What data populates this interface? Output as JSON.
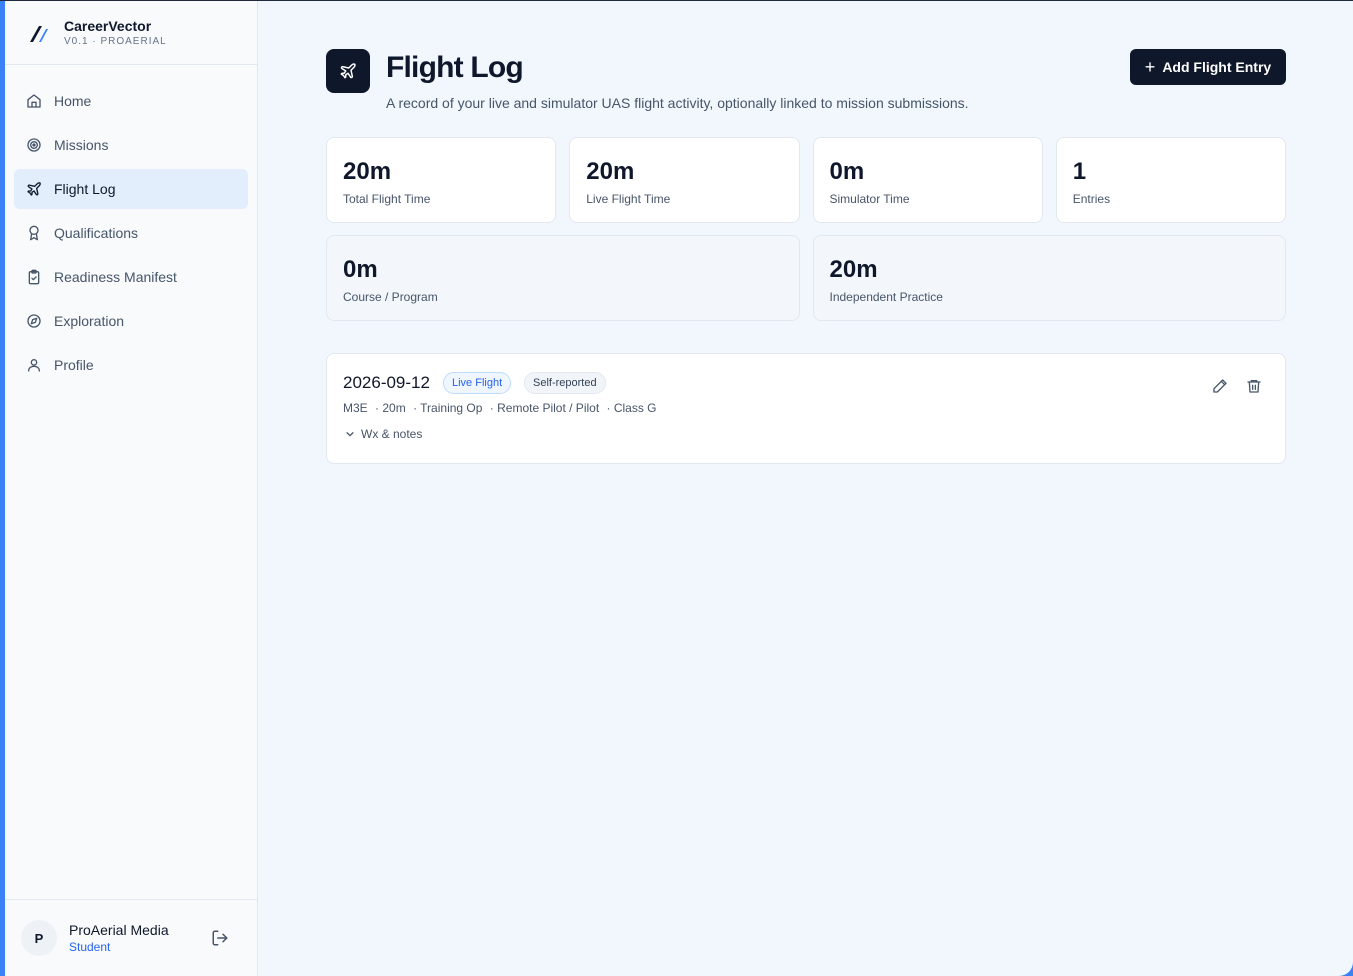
{
  "brand": {
    "name": "CareerVector",
    "version": "V0.1 · PROAERIAL"
  },
  "nav": [
    {
      "label": "Home",
      "icon": "home-icon",
      "active": false
    },
    {
      "label": "Missions",
      "icon": "target-icon",
      "active": false
    },
    {
      "label": "Flight Log",
      "icon": "plane-icon",
      "active": true
    },
    {
      "label": "Qualifications",
      "icon": "award-icon",
      "active": false
    },
    {
      "label": "Readiness Manifest",
      "icon": "clipboard-check-icon",
      "active": false
    },
    {
      "label": "Exploration",
      "icon": "compass-icon",
      "active": false
    },
    {
      "label": "Profile",
      "icon": "user-icon",
      "active": false
    }
  ],
  "user": {
    "initial": "P",
    "name": "ProAerial Media",
    "role": "Student"
  },
  "header": {
    "title": "Flight Log",
    "subtitle": "A record of your live and simulator UAS flight activity, optionally linked to mission submissions.",
    "add_button": "Add Flight Entry"
  },
  "stats": [
    {
      "value": "20m",
      "label": "Total Flight Time"
    },
    {
      "value": "20m",
      "label": "Live Flight Time"
    },
    {
      "value": "0m",
      "label": "Simulator Time"
    },
    {
      "value": "1",
      "label": "Entries"
    }
  ],
  "stats_secondary": [
    {
      "value": "0m",
      "label": "Course / Program"
    },
    {
      "value": "20m",
      "label": "Independent Practice"
    }
  ],
  "entries": [
    {
      "date": "2026-09-12",
      "badge_type": "Live Flight",
      "badge_source": "Self-reported",
      "aircraft": "M3E",
      "duration": "· 20m",
      "operation": "· Training Op",
      "role": "· Remote Pilot / Pilot",
      "airspace": "· Class G",
      "notes_toggle": "Wx & notes"
    }
  ],
  "colors": {
    "primary": "#0f172a",
    "accent": "#2563eb",
    "active_nav_bg": "#e2eefb",
    "window_frame": "#3b82f6"
  }
}
